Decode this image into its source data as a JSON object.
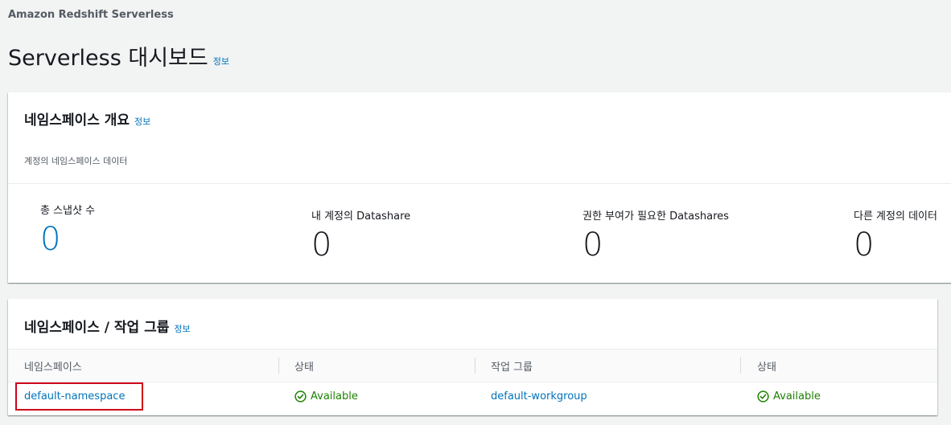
{
  "breadcrumb": "Amazon Redshift Serverless",
  "page_title": "Serverless 대시보드",
  "info_label": "정보",
  "namespace_overview": {
    "title": "네임스페이스 개요",
    "description": "계정의 네임스페이스 데이터",
    "metrics": [
      {
        "label": "총 스냅샷 수",
        "value": "0"
      },
      {
        "label": "내 계정의 Datashare",
        "value": "0"
      },
      {
        "label": "권한 부여가 필요한 Datashares",
        "value": "0"
      },
      {
        "label": "다른 계정의 데이터",
        "value": "0"
      }
    ]
  },
  "workgroups": {
    "title": "네임스페이스 / 작업 그룹",
    "columns": [
      "네임스페이스",
      "상태",
      "작업 그룹",
      "상태"
    ],
    "rows": [
      {
        "namespace": "default-namespace",
        "namespace_status": "Available",
        "workgroup": "default-workgroup",
        "workgroup_status": "Available"
      }
    ]
  },
  "colors": {
    "link": "#0073bb",
    "success": "#1d8102",
    "highlight": "#d0021b"
  }
}
